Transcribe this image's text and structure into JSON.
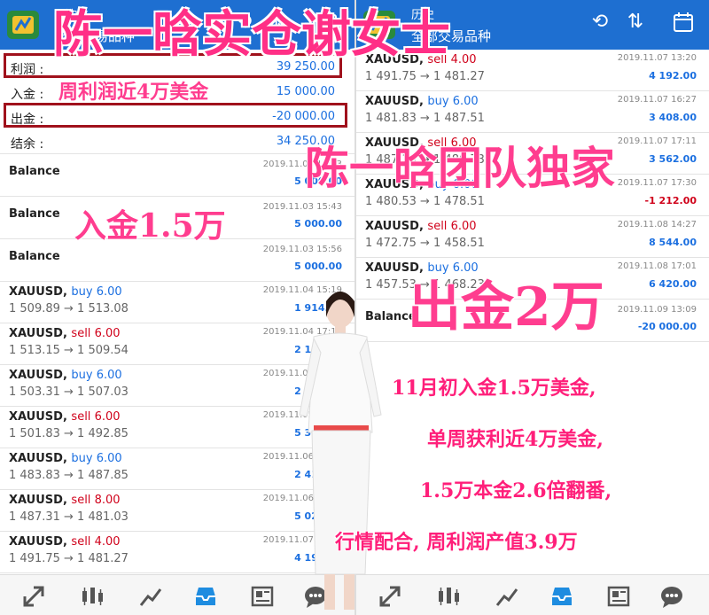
{
  "left": {
    "header": {
      "title": "历史",
      "subtitle": "全部交易品种"
    },
    "summary": [
      {
        "label": "利润 :",
        "value": "39 250.00"
      },
      {
        "label": "入金 :",
        "value": "15 000.00"
      },
      {
        "label": "出金 :",
        "value": "-20 000.00"
      },
      {
        "label": "结余 :",
        "value": "34 250.00"
      }
    ],
    "balances": [
      {
        "label": "Balance",
        "date": "2019.11.03 15:43",
        "value": "5 000.00"
      },
      {
        "label": "Balance",
        "date": "2019.11.03 15:43",
        "value": "5 000.00"
      },
      {
        "label": "Balance",
        "date": "2019.11.03 15:56",
        "value": "5 000.00"
      }
    ],
    "trades": [
      {
        "symbol": "XAUUSD,",
        "side": "buy",
        "lot": "6.00",
        "price": "1 509.89 → 1 513.08",
        "date": "2019.11.04 15:19",
        "profit": "1 914.00"
      },
      {
        "symbol": "XAUUSD,",
        "side": "sell",
        "lot": "6.00",
        "price": "1 513.15 → 1 509.54",
        "date": "2019.11.04 17:13",
        "profit": "2 166.00"
      },
      {
        "symbol": "XAUUSD,",
        "side": "buy",
        "lot": "6.00",
        "price": "1 503.31 → 1 507.03",
        "date": "2019.11.05 09:08",
        "profit": "2 232.00"
      },
      {
        "symbol": "XAUUSD,",
        "side": "sell",
        "lot": "6.00",
        "price": "1 501.83 → 1 492.85",
        "date": "2019.11.05 18:20",
        "profit": "5 388.00"
      },
      {
        "symbol": "XAUUSD,",
        "side": "buy",
        "lot": "6.00",
        "price": "1 483.83 → 1 487.85",
        "date": "2019.11.06 15:47",
        "profit": "2 412.00"
      },
      {
        "symbol": "XAUUSD,",
        "side": "sell",
        "lot": "8.00",
        "price": "1 487.31 → 1 481.03",
        "date": "2019.11.06 16:27",
        "profit": "5 024.00"
      },
      {
        "symbol": "XAUUSD,",
        "side": "sell",
        "lot": "4.00",
        "price": "1 491.75 → 1 481.27",
        "date": "2019.11.07 13:20",
        "profit": "4 192.00"
      }
    ]
  },
  "right": {
    "header": {
      "title": "历史",
      "subtitle": "全部交易品种"
    },
    "trades": [
      {
        "symbol": "XAUUSD,",
        "side": "sell",
        "lot": "4.00",
        "price": "1 491.75 → 1 481.27",
        "date": "2019.11.07 13:20",
        "profit": "4 192.00",
        "neg": false
      },
      {
        "symbol": "XAUUSD,",
        "side": "buy",
        "lot": "6.00",
        "price": "1 481.83 → 1 487.51",
        "date": "2019.11.07 16:27",
        "profit": "3 408.00",
        "neg": false
      },
      {
        "symbol": "XAUUSD,",
        "side": "sell",
        "lot": "6.00",
        "price": "1 487.10 → 1 480.73",
        "date": "2019.11.07 17:11",
        "profit": "3 562.00",
        "neg": false
      },
      {
        "symbol": "XAUUSD,",
        "side": "buy",
        "lot": "6.00",
        "price": "1 480.53 → 1 478.51",
        "date": "2019.11.07 17:30",
        "profit": "-1 212.00",
        "neg": true
      },
      {
        "symbol": "XAUUSD,",
        "side": "sell",
        "lot": "6.00",
        "price": "1 472.75 → 1 458.51",
        "date": "2019.11.08 14:27",
        "profit": "8 544.00",
        "neg": false
      },
      {
        "symbol": "XAUUSD,",
        "side": "buy",
        "lot": "6.00",
        "price": "1 457.53 → 1 468.23",
        "date": "2019.11.08 17:01",
        "profit": "6 420.00",
        "neg": false
      }
    ],
    "withdrawal": {
      "label": "Balance",
      "date": "2019.11.09 13:09",
      "value": "-20 000.00"
    }
  },
  "overlay": {
    "title": "陈一晗实仓谢女士",
    "weekly": "周利润近4万美金",
    "team": "陈一晗团队独家",
    "deposit": "入金1.5万",
    "withdraw": "出金2万",
    "note1": "11月初入金1.5万美金,",
    "note2": "单周获利近4万美金,",
    "note3": "1.5万本金2.6倍翻番,",
    "note4": "行情配合, 周利润产值3.9万"
  },
  "colors": {
    "header": "#1e6fd1",
    "buy": "#1b6fe0",
    "sell": "#d0021b",
    "overlay": "#ff3d8f",
    "highlight": "#a0111c"
  },
  "icons": [
    "logo-icon",
    "clock-history-icon",
    "sort-icon",
    "calendar-icon",
    "trade-nav-icon",
    "chart-nav-icon",
    "trend-nav-icon",
    "inbox-nav-icon",
    "news-nav-icon",
    "chat-nav-icon"
  ]
}
